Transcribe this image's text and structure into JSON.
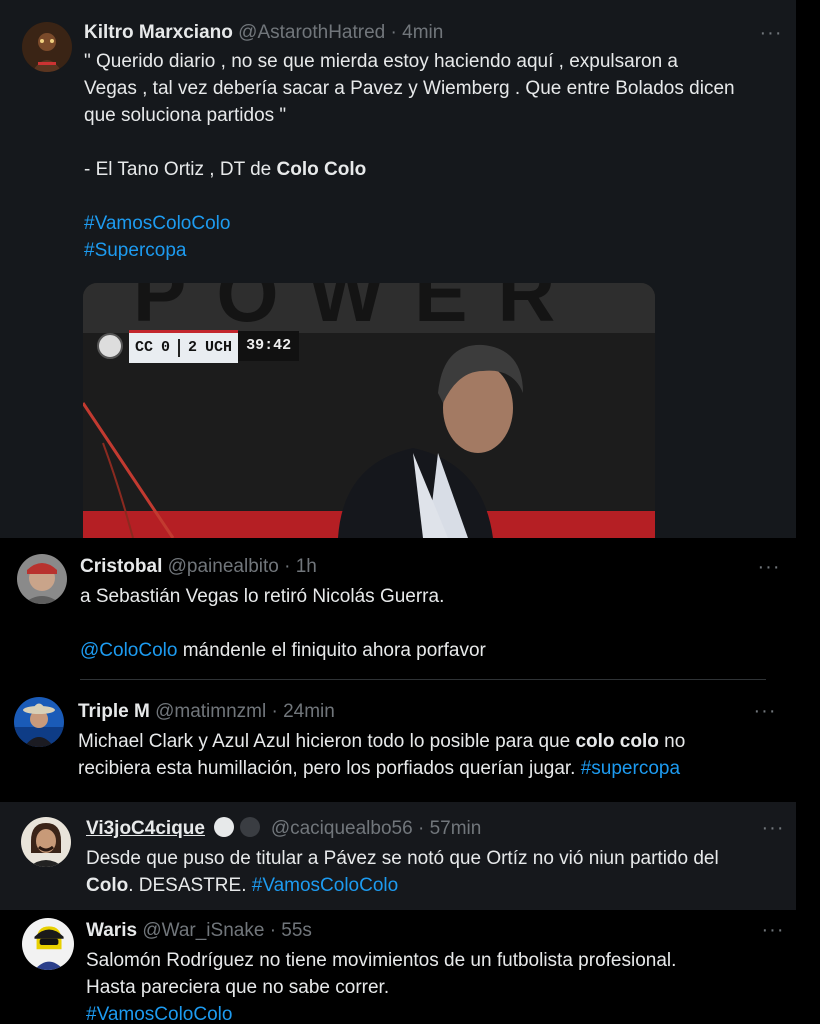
{
  "tweets": [
    {
      "name": "Kiltro Marxciano",
      "handle": "@AstarothHatred",
      "time": "4min",
      "lines": [
        "\" Querido diario , no se que mierda estoy haciendo aquí , expulsaron a",
        "Vegas , tal vez debería sacar a Pavez y Wiemberg . Que entre Bolados dicen",
        "que soluciona partidos \""
      ],
      "sign_prefix": "- El Tano Ortiz , DT de ",
      "sign_bold": "Colo Colo",
      "hashtags": [
        "#VamosColoColo",
        "#Supercopa"
      ],
      "media": {
        "score_home": "CC",
        "score_home_goals": "0",
        "score_away_goals": "2",
        "score_away": "UCH",
        "clock": "39:42",
        "banner_text": "POWER"
      }
    },
    {
      "name": "Cristobal",
      "handle": "@painealbito",
      "time": "1h",
      "line1": "a Sebastián Vegas lo retiró Nicolás Guerra.",
      "mention": "@ColoColo",
      "line2_rest": " mándenle el finiquito ahora porfavor"
    },
    {
      "name": "Triple M",
      "handle": "@matimnzml",
      "time": "24min",
      "line1_a": "Michael Clark y Azul Azul hicieron todo lo posible para que ",
      "line1_bold": "colo colo",
      "line1_b": " no",
      "line2_a": "recibiera esta humillación, pero los porfiados querían jugar. ",
      "line2_tag": "#supercopa"
    },
    {
      "name": "Vi3joC4cique",
      "handle": "@caciquealbo56",
      "time": "57min",
      "line1": "Desde que puso de titular a Pávez se notó que Ortíz no vió niun partido del",
      "line2_bold": "Colo",
      "line2_mid": ". DESASTRE. ",
      "line2_tag": "#VamosColoColo"
    },
    {
      "name": "Waris",
      "handle": "@War_iSnake",
      "time": "55s",
      "line1": "Salomón Rodríguez no tiene movimientos de un futbolista profesional.",
      "line2": "Hasta pareciera que no sabe correr.",
      "tag": "#VamosColoColo"
    }
  ],
  "more_label": "···",
  "dot": "·"
}
